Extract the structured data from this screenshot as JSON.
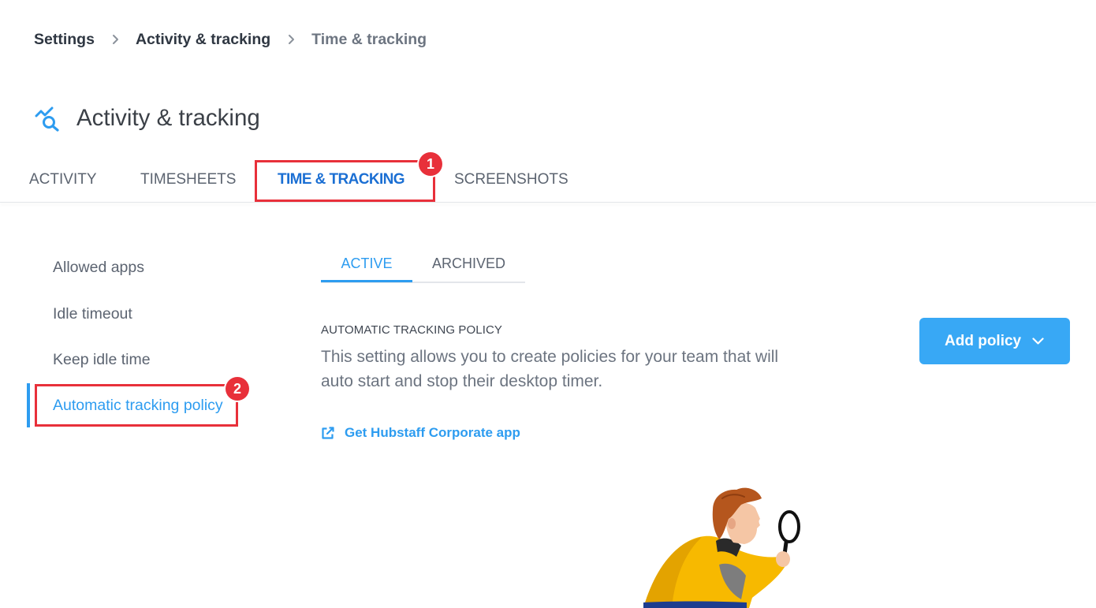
{
  "colors": {
    "accent": "#2d9cf0",
    "tab_active": "#1b6fd3",
    "annotation_red": "#e8303a",
    "button_bg": "#38a8f5"
  },
  "breadcrumb": {
    "items": [
      "Settings",
      "Activity & tracking",
      "Time & tracking"
    ],
    "separator_icon": "chevron-right-icon"
  },
  "page": {
    "icon": "activity-search-icon",
    "title": "Activity & tracking"
  },
  "tabs": [
    {
      "label": "ACTIVITY",
      "active": false
    },
    {
      "label": "TIMESHEETS",
      "active": false
    },
    {
      "label": "TIME & TRACKING",
      "active": true
    },
    {
      "label": "SCREENSHOTS",
      "active": false
    }
  ],
  "sidebar": {
    "items": [
      {
        "label": "Allowed apps",
        "active": false
      },
      {
        "label": "Idle timeout",
        "active": false
      },
      {
        "label": "Keep idle time",
        "active": false
      },
      {
        "label": "Automatic tracking policy",
        "active": true
      }
    ]
  },
  "subtabs": [
    {
      "label": "ACTIVE",
      "active": true
    },
    {
      "label": "ARCHIVED",
      "active": false
    }
  ],
  "section": {
    "heading": "AUTOMATIC TRACKING POLICY",
    "description": "This setting allows you to create policies for your team that will auto start and stop their desktop timer.",
    "link": {
      "label": "Get Hubstaff Corporate app",
      "icon": "external-link-icon"
    }
  },
  "add_policy_button": {
    "label": "Add policy",
    "icon": "chevron-down-icon"
  },
  "annotations": [
    {
      "number": "1"
    },
    {
      "number": "2"
    }
  ]
}
